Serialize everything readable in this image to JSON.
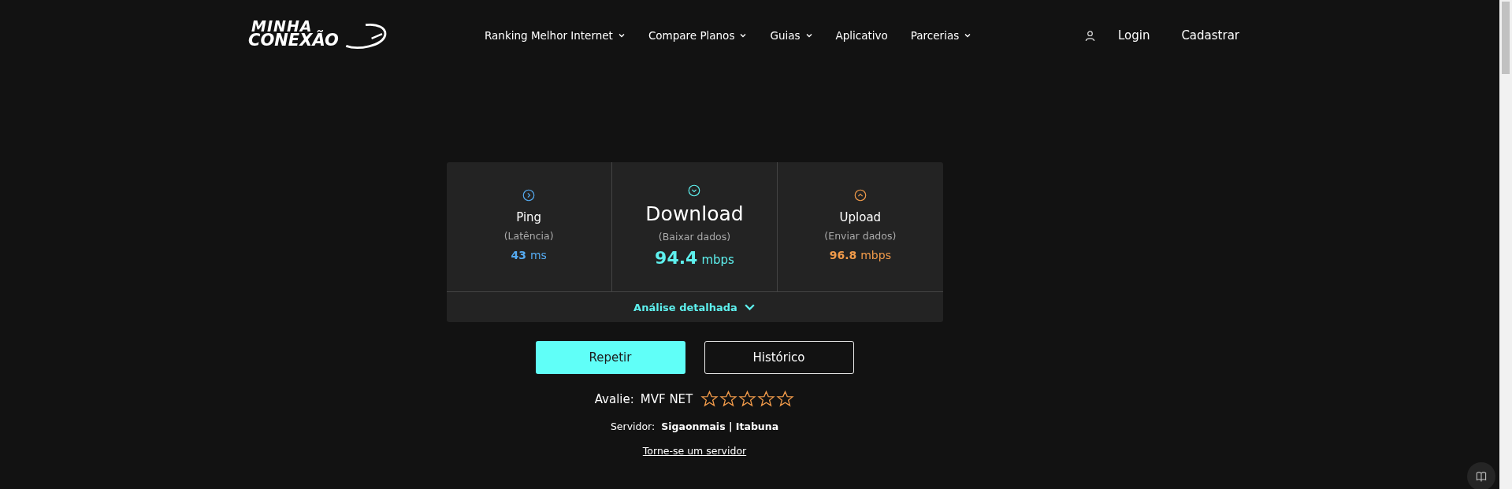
{
  "header": {
    "logo": {
      "line1": "MINHA",
      "line2": "CONEXÃO"
    },
    "nav": [
      {
        "label": "Ranking Melhor Internet",
        "dropdown": true
      },
      {
        "label": "Compare Planos",
        "dropdown": true
      },
      {
        "label": "Guias",
        "dropdown": true
      },
      {
        "label": "Aplicativo",
        "dropdown": false
      },
      {
        "label": "Parcerias",
        "dropdown": true
      }
    ],
    "login": "Login",
    "register": "Cadastrar"
  },
  "metrics": [
    {
      "kind": "ping",
      "title": "Ping",
      "subtitle": "(Latência)",
      "value": "43",
      "unit": "ms",
      "color": "#55aaf0"
    },
    {
      "kind": "download",
      "title": "Download",
      "subtitle": "(Baixar dados)",
      "value": "94.4",
      "unit": "mbps",
      "color": "#5ef0ee"
    },
    {
      "kind": "upload",
      "title": "Upload",
      "subtitle": "(Enviar dados)",
      "value": "96.8",
      "unit": "mbps",
      "color": "#f09a4a"
    }
  ],
  "details_toggle": {
    "label": "Análise detalhada",
    "expanded": false
  },
  "buttons": [
    {
      "label": "Repetir",
      "kind": "primary"
    },
    {
      "label": "Histórico",
      "kind": "outline"
    }
  ],
  "rating": {
    "label": "Avalie:",
    "provider": "MVF NET",
    "stars": 0
  },
  "server": {
    "label": "Servidor:",
    "name": "Sigaonmais | Itabuna"
  },
  "become_server_link": "Torne-se um servidor"
}
